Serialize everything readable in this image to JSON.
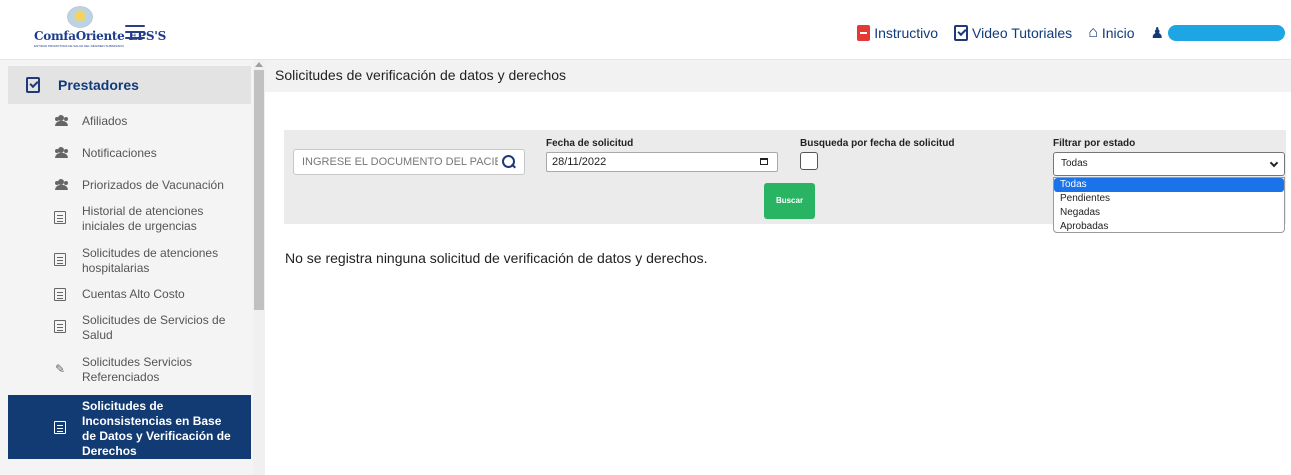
{
  "brand": {
    "name": "ComfaOriente EPS'S",
    "tagline": "ENTIDAD PROMOTORA DE SALUD DEL RÉGIMEN SUBSIDIADO"
  },
  "topnav": {
    "instructivo": "Instructivo",
    "video_tutoriales": "Video Tutoriales",
    "inicio": "Inicio"
  },
  "sidebar": {
    "header": "Prestadores",
    "items": [
      {
        "label": "Afiliados",
        "icon": "users-icon"
      },
      {
        "label": "Notificaciones",
        "icon": "users-icon"
      },
      {
        "label": "Priorizados de Vacunación",
        "icon": "users-icon"
      },
      {
        "label": "Historial de atenciones iniciales de urgencias",
        "icon": "document-icon"
      },
      {
        "label": "Solicitudes de atenciones hospitalarias",
        "icon": "document-icon"
      },
      {
        "label": "Cuentas Alto Costo",
        "icon": "clipboard-icon"
      },
      {
        "label": "Solicitudes de Servicios de Salud",
        "icon": "document-icon"
      },
      {
        "label": "Solicitudes Servicios Referenciados",
        "icon": "edit-document-icon"
      },
      {
        "label": "Solicitudes de Inconsistencias en Base de Datos y Verificación de Derechos",
        "icon": "document-icon",
        "active": true
      }
    ]
  },
  "main": {
    "title": "Solicitudes de verificación de datos y derechos",
    "filters": {
      "document_placeholder": "INGRESE EL DOCUMENTO DEL PACIENTE",
      "date_label": "Fecha de solicitud",
      "date_value": "28/11/2022",
      "search_by_date_label": "Busqueda por fecha de solicitud",
      "search_by_date_checked": false,
      "buscar_label": "Buscar",
      "status_label": "Filtrar por estado",
      "status_selected": "Todas",
      "status_options": [
        "Todas",
        "Pendientes",
        "Negadas",
        "Aprobadas"
      ]
    },
    "empty_message": "No se registra ninguna solicitud de verificación de datos y derechos."
  },
  "colors": {
    "brand_navy": "#123a73",
    "buscar_green": "#28b463",
    "user_pill": "#1ea5e3",
    "pdf_red": "#e53935"
  }
}
